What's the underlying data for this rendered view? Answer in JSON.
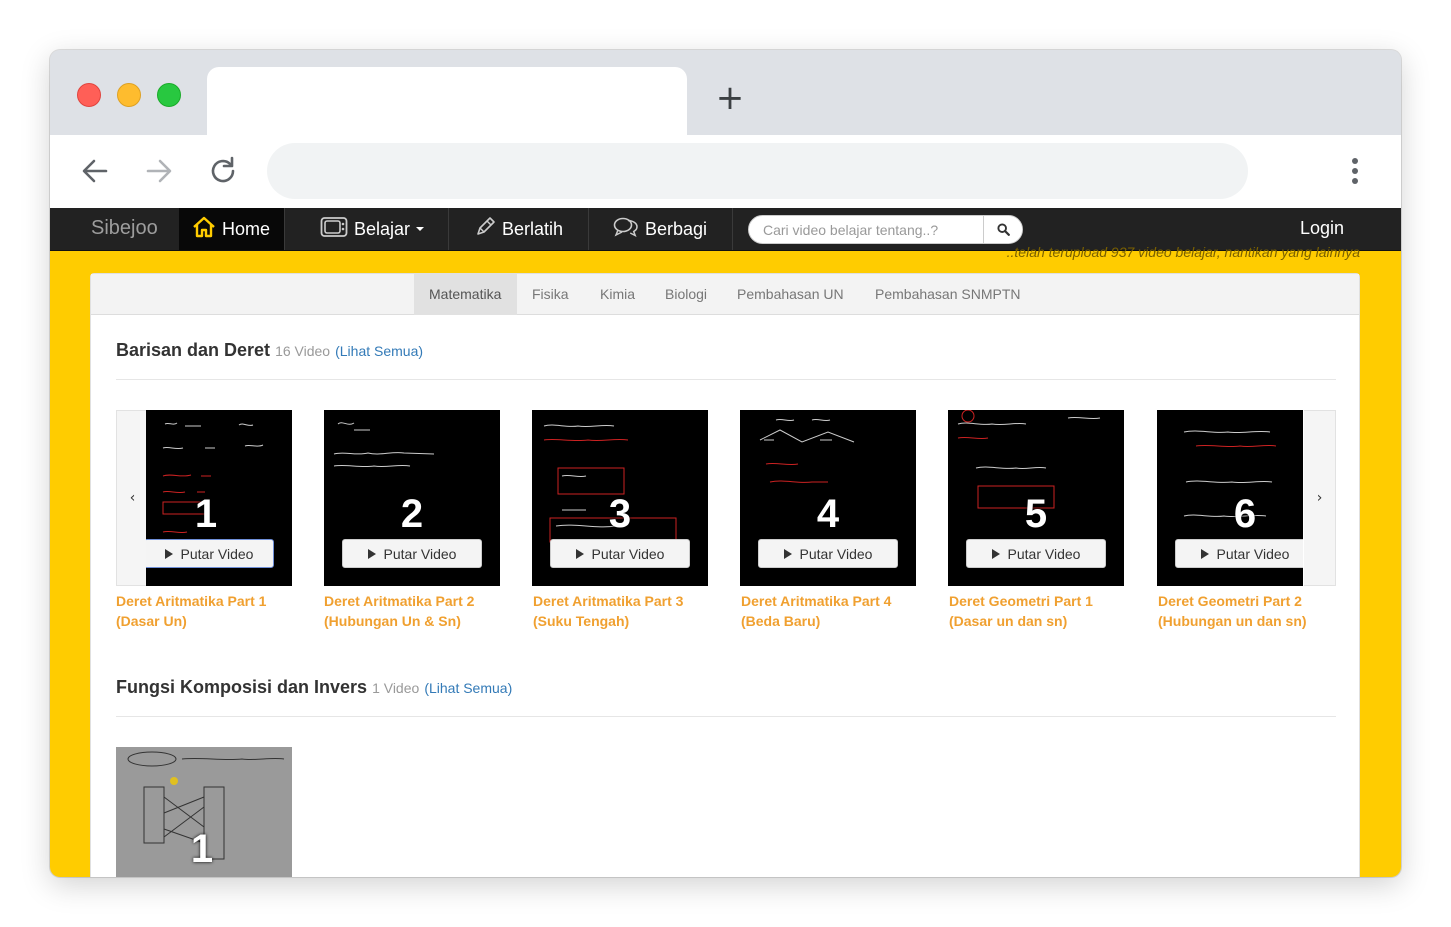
{
  "browser": {
    "new_tab_symbol": "+",
    "colors": {
      "chrome": "#dee1e6",
      "close": "#ff5f57",
      "minimize": "#febc2e",
      "maximize": "#28c840"
    }
  },
  "site": {
    "brand": "Sibejoo",
    "nav": {
      "home": "Home",
      "belajar": "Belajar",
      "berlatih": "Berlatih",
      "berbagi": "Berbagi"
    },
    "search": {
      "placeholder": "Cari video belajar tentang..?"
    },
    "login": "Login",
    "marquee": "..telah terupload 937 video belajar, nantikan yang lainnya",
    "colors": {
      "background": "#ffcc00",
      "navbar": "#222222",
      "card_title": "#f0a030",
      "link": "#337ab7"
    }
  },
  "subjects": [
    "Matematika",
    "Fisika",
    "Kimia",
    "Biologi",
    "Pembahasan UN",
    "Pembahasan SNMPTN"
  ],
  "sections": [
    {
      "title": "Barisan dan Deret",
      "count": "16 Video",
      "see_all": "(Lihat Semua)",
      "play_label": "Putar Video",
      "videos": [
        {
          "number": "1",
          "title": "Deret Aritmatika Part 1 (Dasar Un)"
        },
        {
          "number": "2",
          "title": "Deret Aritmatika Part 2 (Hubungan Un & Sn)"
        },
        {
          "number": "3",
          "title": "Deret Aritmatika Part 3 (Suku Tengah)"
        },
        {
          "number": "4",
          "title": "Deret Aritmatika Part 4 (Beda Baru)"
        },
        {
          "number": "5",
          "title": "Deret Geometri Part 1 (Dasar un dan sn)"
        },
        {
          "number": "6",
          "title": "Deret Geometri Part 2 (Hubungan un dan sn)"
        }
      ]
    },
    {
      "title": "Fungsi Komposisi dan Invers",
      "count": "1 Video",
      "see_all": "(Lihat Semua)",
      "videos": [
        {
          "number": "1"
        }
      ]
    }
  ],
  "icons": {
    "back": "back-arrow-icon",
    "forward": "forward-arrow-icon",
    "reload": "reload-icon",
    "menu": "kebab-menu-icon",
    "home": "house-icon",
    "belajar": "tv-icon",
    "berlatih": "pencil-icon",
    "berbagi": "chat-bubbles-icon",
    "search": "magnifier-icon",
    "prev": "chevron-left-icon",
    "next": "chevron-right-icon",
    "play": "play-triangle-icon"
  }
}
